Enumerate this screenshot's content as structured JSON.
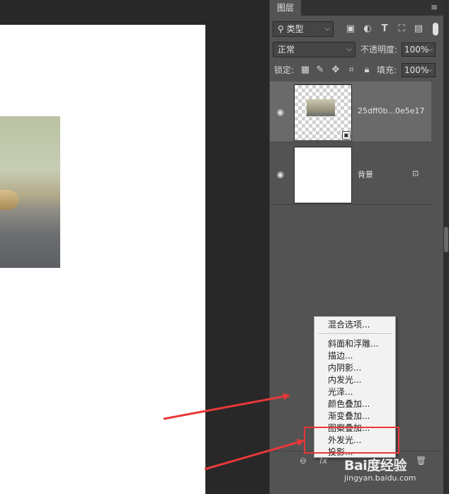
{
  "panel": {
    "tab_title": "图层",
    "menu_icon": "hamburger-menu-icon",
    "filter": {
      "selected": "类型",
      "icon": "search-icon"
    },
    "filter_icons": [
      "image-filter-icon",
      "adjustment-filter-icon",
      "type-filter-icon",
      "shape-filter-icon",
      "smart-object-filter-icon"
    ],
    "blend_mode": "正常",
    "opacity_label": "不透明度:",
    "opacity_value": "100%",
    "lock_label": "锁定:",
    "lock_icons": [
      "lock-transparency-icon",
      "lock-image-icon",
      "lock-position-icon",
      "lock-artboard-icon",
      "lock-all-icon"
    ],
    "fill_label": "填充:",
    "fill_value": "100%"
  },
  "layers": [
    {
      "name": "25dff0b...0e5e17",
      "visible": true,
      "selected": true,
      "smart_object": true
    },
    {
      "name": "背景",
      "visible": true,
      "locked": true
    }
  ],
  "bottom_bar": {
    "icons": [
      "link-layers-icon",
      "fx-icon",
      "trash-icon"
    ],
    "fx_label": "fx"
  },
  "context_menu": {
    "header_item": "混合选项...",
    "items": [
      "斜面和浮雕...",
      "描边...",
      "内阴影...",
      "内发光...",
      "光泽...",
      "颜色叠加...",
      "渐变叠加...",
      "图案叠加...",
      "外发光...",
      "投影..."
    ],
    "highlighted_item": "外发光..."
  },
  "annotation": {
    "arrow_color": "#e8383a",
    "box_color": "#e8383a"
  },
  "watermark": {
    "logo": "Bai度经验",
    "url": "jingyan.baidu.com"
  }
}
